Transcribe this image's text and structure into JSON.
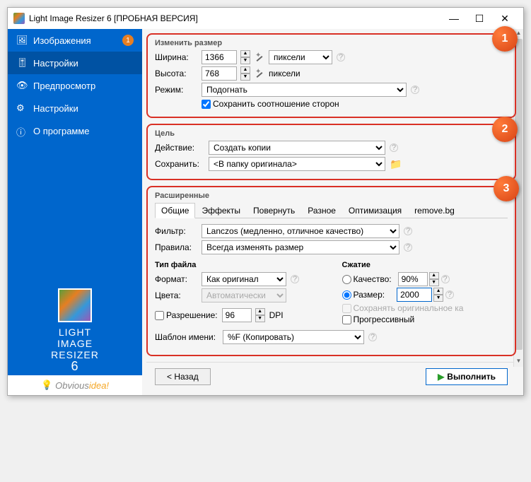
{
  "window": {
    "title": "Light Image Resizer 6  [ПРОБНАЯ ВЕРСИЯ]"
  },
  "sidebar": {
    "items": [
      {
        "label": "Изображения",
        "badge": "1"
      },
      {
        "label": "Настройки"
      },
      {
        "label": "Предпросмотр"
      },
      {
        "label": "Настройки"
      },
      {
        "label": "О программе"
      }
    ],
    "logo_l1": "LIGHT",
    "logo_l2": "IMAGE",
    "logo_l3": "RESIZER",
    "logo_v": "6",
    "brand": "Obvious",
    "brand2": "idea",
    "brand_excl": "!"
  },
  "size": {
    "title": "Изменить размер",
    "width_lab": "Ширина:",
    "width_val": "1366",
    "width_unit": "пиксели",
    "height_lab": "Высота:",
    "height_val": "768",
    "height_unit": "пиксели",
    "mode_lab": "Режим:",
    "mode_val": "Подогнать",
    "keep_ratio": "Сохранить соотношение сторон"
  },
  "target": {
    "title": "Цель",
    "action_lab": "Действие:",
    "action_val": "Создать копии",
    "save_lab": "Сохранить:",
    "save_val": "<В папку оригинала>"
  },
  "adv": {
    "title": "Расширенные",
    "tabs": [
      "Общие",
      "Эффекты",
      "Повернуть",
      "Разное",
      "Оптимизация",
      "remove.bg"
    ],
    "filter_lab": "Фильтр:",
    "filter_val": "Lanczos  (медленно, отличное качество)",
    "rules_lab": "Правила:",
    "rules_val": "Всегда изменять размер",
    "filetype_head": "Тип файла",
    "format_lab": "Формат:",
    "format_val": "Как оригинал",
    "colors_lab": "Цвета:",
    "colors_val": "Автоматически",
    "res_lab": "Разрешение:",
    "res_val": "96",
    "res_unit": "DPI",
    "compress_head": "Сжатие",
    "quality_lab": "Качество:",
    "quality_val": "90%",
    "sizekb_lab": "Размер:",
    "sizekb_val": "2000",
    "keep_orig": "Сохранять оригинальное ка",
    "progressive": "Прогрессивный",
    "name_lab": "Шаблон имени:",
    "name_val": "%F (Копировать)"
  },
  "callouts": {
    "c1": "1",
    "c2": "2",
    "c3": "3"
  },
  "footer": {
    "back": "< Назад",
    "run": "Выполнить"
  }
}
